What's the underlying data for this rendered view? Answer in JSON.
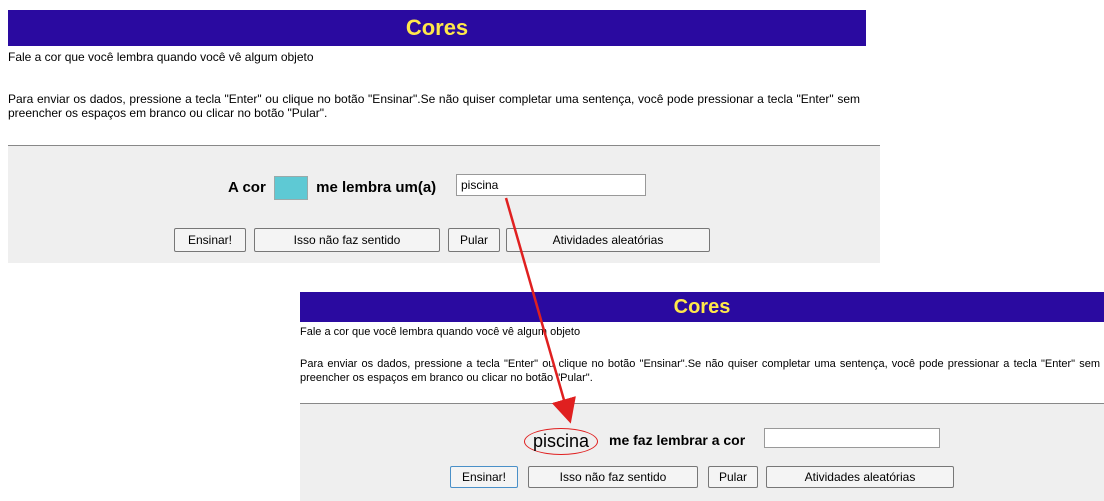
{
  "top": {
    "title": "Cores",
    "intro": "Fale a cor que você lembra quando você vê algum objeto",
    "instructions": "Para enviar os dados, pressione a tecla \"Enter\" ou clique no botão \"Ensinar\".Se não quiser completar uma sentença, você pode pressionar a tecla \"Enter\" sem preencher os espaços em branco ou clicar no botão \"Pular\".",
    "sentence_prefix": "A cor",
    "sentence_middle": "me lembra um(a)",
    "swatch_color": "#5ec9d4",
    "answer_value": "piscina",
    "buttons": {
      "teach": "Ensinar!",
      "nonsense": "Isso não faz sentido",
      "skip": "Pular",
      "random": "Atividades aleatórias"
    }
  },
  "bottom": {
    "title": "Cores",
    "intro": "Fale a cor que você lembra quando você vê algum objeto",
    "instructions": "Para enviar os dados, pressione a tecla \"Enter\" ou clique no botão \"Ensinar\".Se não quiser completar uma sentença, você pode pressionar a tecla \"Enter\" sem preencher os espaços em branco ou clicar no botão \"Pular\".",
    "word": "piscina",
    "sentence_rest": "me faz lembrar a cor",
    "answer_value": "",
    "buttons": {
      "teach": "Ensinar!",
      "nonsense": "Isso não faz sentido",
      "skip": "Pular",
      "random": "Atividades aleatórias"
    }
  },
  "colors": {
    "title_bar": "#2a0aa0",
    "title_text": "#ffe84a",
    "arrow": "#e02020"
  }
}
